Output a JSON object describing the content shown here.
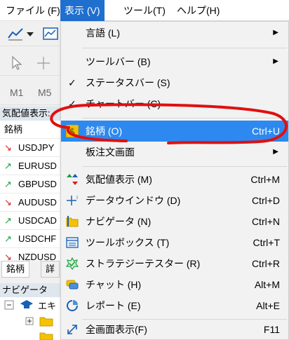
{
  "menubar": {
    "file": "ファイル (F)",
    "view": "表示 (V)",
    "tools": "ツール(T)",
    "help": "ヘルプ(H)"
  },
  "left_panel": {
    "toolbar_m1": "M1",
    "toolbar_m5": "M5",
    "market_watch_title": "気配値表示:",
    "symbol_header": "銘柄",
    "symbols": [
      {
        "name": "USDJPY",
        "dir": "down"
      },
      {
        "name": "EURUSD",
        "dir": "up"
      },
      {
        "name": "GBPUSD",
        "dir": "up"
      },
      {
        "name": "AUDUSD",
        "dir": "down"
      },
      {
        "name": "USDCAD",
        "dir": "up"
      },
      {
        "name": "USDCHF",
        "dir": "up"
      },
      {
        "name": "NZDUSD",
        "dir": "down"
      }
    ],
    "tabs": [
      "銘柄",
      "詳"
    ],
    "navigator_title": "ナビゲータ",
    "navigator_root": "エキ"
  },
  "view_menu": {
    "items": [
      {
        "label": "言語 (L)",
        "shortcut": "",
        "submenu": true
      },
      {
        "label": "ツールバー (B)",
        "shortcut": "",
        "submenu": true
      },
      {
        "label": "ステータスバー (S)",
        "shortcut": "",
        "checked": true
      },
      {
        "label": "チャートバー (C)",
        "shortcut": "",
        "checked": true
      },
      {
        "label": "銘柄 (O)",
        "shortcut": "Ctrl+U",
        "highlighted": true
      },
      {
        "label": "板注文画面",
        "shortcut": "",
        "submenu": true
      },
      {
        "label": "気配値表示 (M)",
        "shortcut": "Ctrl+M"
      },
      {
        "label": "データウインドウ (D)",
        "shortcut": "Ctrl+D"
      },
      {
        "label": "ナビゲータ (N)",
        "shortcut": "Ctrl+N"
      },
      {
        "label": "ツールボックス (T)",
        "shortcut": "Ctrl+T"
      },
      {
        "label": "ストラテジーテスター (R)",
        "shortcut": "Ctrl+R"
      },
      {
        "label": "チャット (H)",
        "shortcut": "Alt+M"
      },
      {
        "label": "レポート (E)",
        "shortcut": "Alt+E"
      },
      {
        "label": "全画面表示(F)",
        "shortcut": "F11"
      }
    ]
  },
  "colors": {
    "highlight": "#2d89ef",
    "menubar_active": "#1f6fcf",
    "annotation": "#e01010"
  }
}
